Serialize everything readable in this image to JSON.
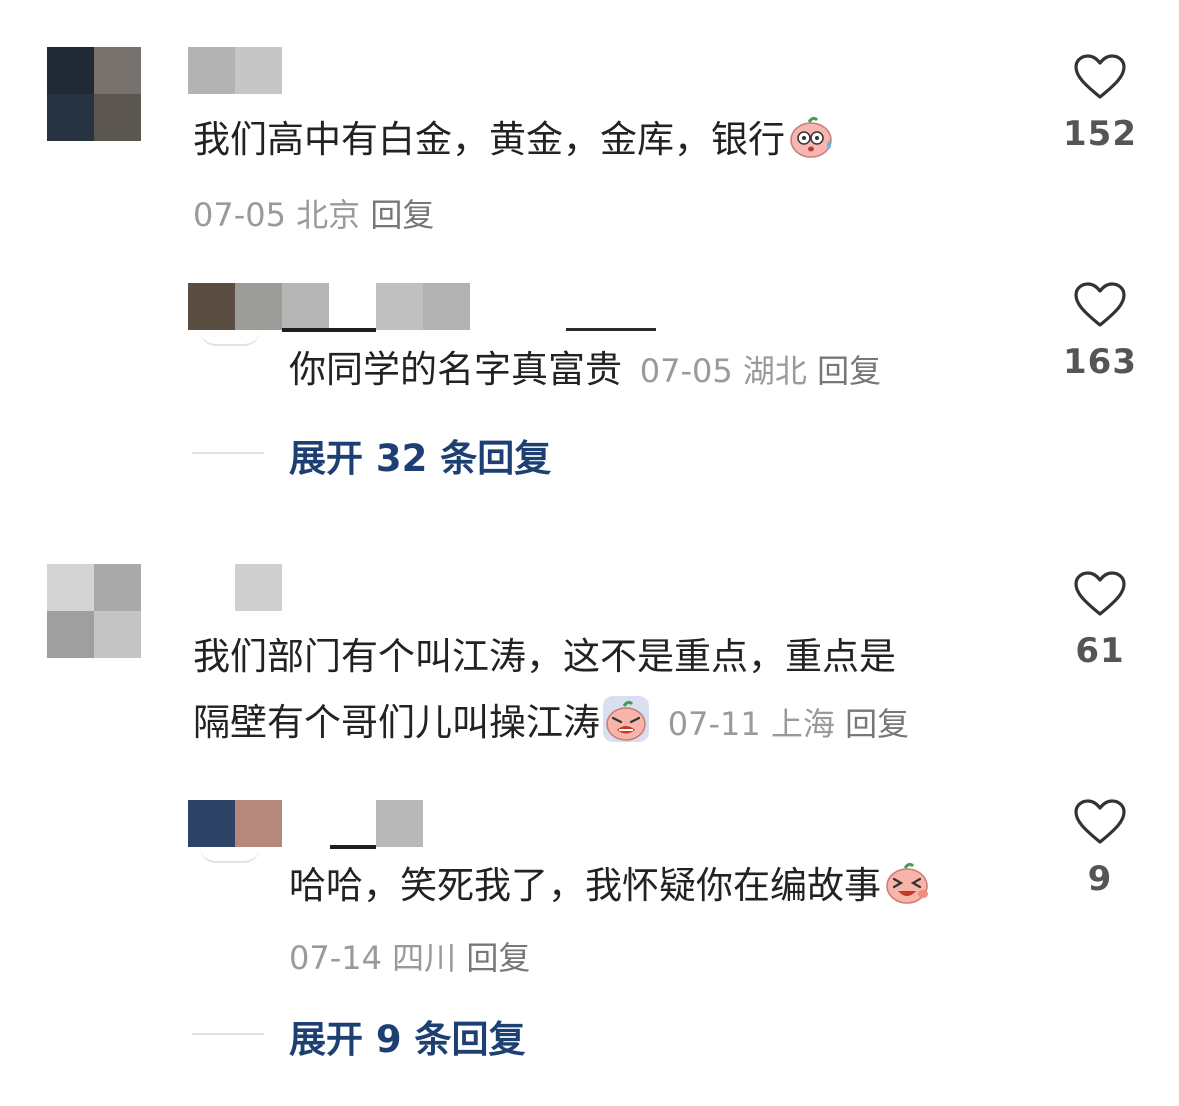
{
  "comments": [
    {
      "text": "我们高中有白金，黄金，金库，银行",
      "emoji": "sweat-face-emoji",
      "date": "07-05",
      "location": "北京",
      "reply_label": "回复",
      "likes": "152",
      "replies": [
        {
          "text": "你同学的名字真富贵",
          "date": "07-05",
          "location": "湖北",
          "reply_label": "回复",
          "likes": "163"
        }
      ],
      "expand_label": "展开 32 条回复"
    },
    {
      "text_line1": "我们部门有个叫江涛，这不是重点，重点是",
      "text_line2": "隔壁有个哥们儿叫操江涛",
      "emoji": "crying-face-emoji",
      "date": "07-11",
      "location": "上海",
      "reply_label": "回复",
      "likes": "61",
      "replies": [
        {
          "text": "哈哈，笑死我了，我怀疑你在编故事",
          "emoji": "laughing-face-emoji",
          "date": "07-14",
          "location": "四川",
          "reply_label": "回复",
          "likes": "9"
        }
      ],
      "expand_label": "展开 9 条回复"
    }
  ],
  "icons": {
    "like": "heart-outline-icon"
  },
  "colors": {
    "text": "#222222",
    "meta": "#9a9a9a",
    "expand": "#1d3f72",
    "icon": "#333333"
  }
}
